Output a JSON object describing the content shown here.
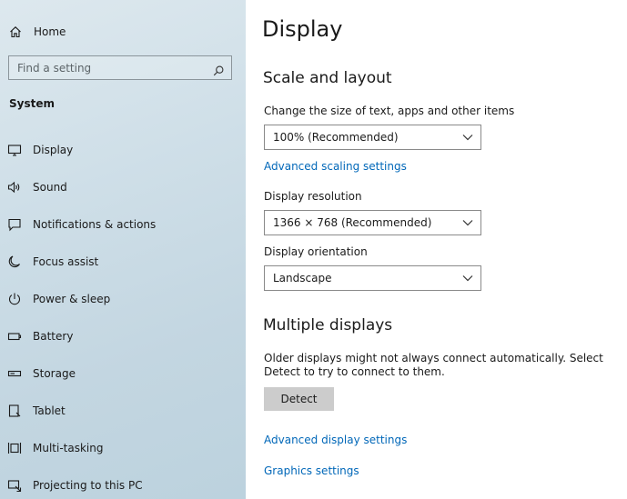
{
  "sidebar": {
    "home_label": "Home",
    "search_placeholder": "Find a setting",
    "section_title": "System",
    "items": [
      {
        "label": "Display",
        "icon": "monitor-icon"
      },
      {
        "label": "Sound",
        "icon": "speaker-icon"
      },
      {
        "label": "Notifications & actions",
        "icon": "notification-icon"
      },
      {
        "label": "Focus assist",
        "icon": "moon-icon"
      },
      {
        "label": "Power & sleep",
        "icon": "power-icon"
      },
      {
        "label": "Battery",
        "icon": "battery-icon"
      },
      {
        "label": "Storage",
        "icon": "storage-icon"
      },
      {
        "label": "Tablet",
        "icon": "tablet-icon"
      },
      {
        "label": "Multi-tasking",
        "icon": "multitasking-icon"
      },
      {
        "label": "Projecting to this PC",
        "icon": "projecting-icon"
      }
    ]
  },
  "main": {
    "title": "Display",
    "scale": {
      "heading": "Scale and layout",
      "size_label": "Change the size of text, apps and other items",
      "size_value": "100% (Recommended)",
      "advanced_link": "Advanced scaling settings",
      "resolution_label": "Display resolution",
      "resolution_value": "1366 × 768 (Recommended)",
      "orientation_label": "Display orientation",
      "orientation_value": "Landscape"
    },
    "multiple": {
      "heading": "Multiple displays",
      "description": "Older displays might not always connect automatically. Select Detect to try to connect to them.",
      "detect_button": "Detect",
      "advanced_display_link": "Advanced display settings",
      "graphics_link": "Graphics settings"
    }
  },
  "colors": {
    "link": "#0067b8",
    "button_bg": "#cccccc",
    "sidebar_bg": "#c9dce6"
  }
}
